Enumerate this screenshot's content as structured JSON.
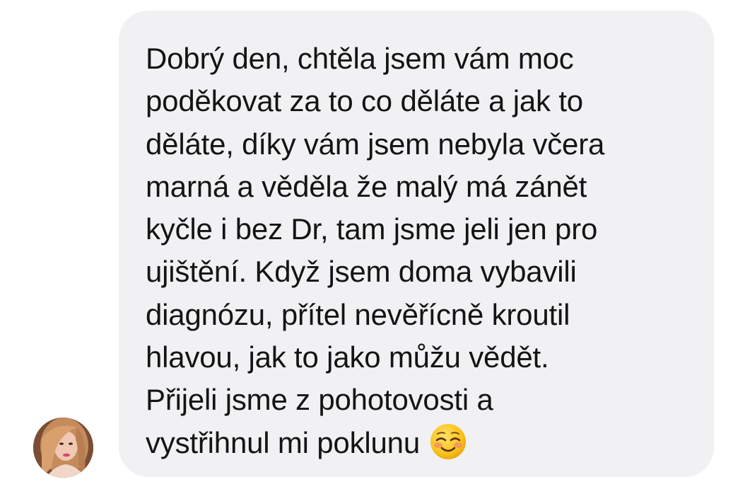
{
  "message": {
    "lines": [
      "Dobrý den, chtěla jsem vám moc",
      "poděkovat za to co děláte a jak to",
      "děláte, díky vám jsem nebyla včera",
      "marná a věděla že malý má zánět",
      "kyčle i bez Dr, tam jsme jeli jen pro",
      "ujištění. Když jsem doma vybavili",
      "diagnózu, přítel nevěřícně kroutil",
      "hlavou, jak to jako můžu vědět.",
      "Přijeli jsme z pohotovosti a",
      "vystřihnul mi poklunu"
    ],
    "emoji_icon": "smiling-face-emoji"
  },
  "sender": {
    "avatar_icon": "user-avatar-photo"
  },
  "colors": {
    "bubble_background": "#f1f1f3",
    "text": "#141414",
    "page_background": "#ffffff"
  }
}
